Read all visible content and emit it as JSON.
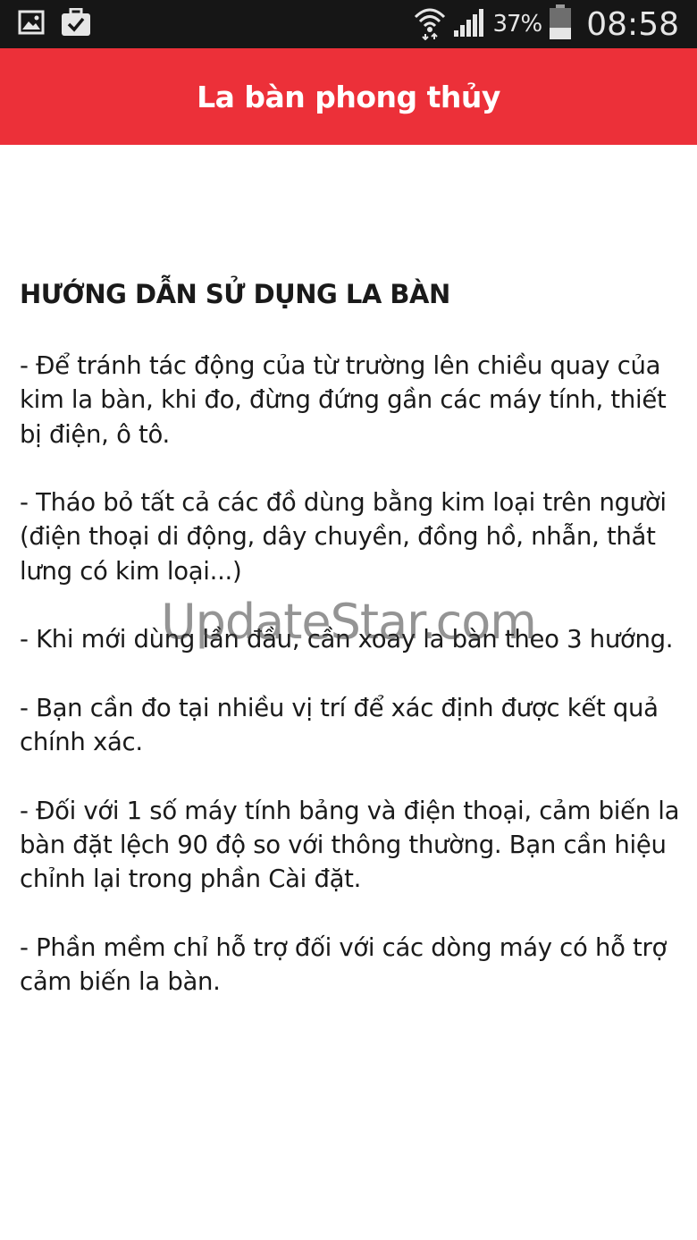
{
  "status_bar": {
    "icons_left": [
      "gallery-icon",
      "briefcase-check-icon"
    ],
    "icons_right": [
      "wifi-icon",
      "signal-icon",
      "battery-icon"
    ],
    "battery_percent": "37%",
    "battery_level": 0.37,
    "time": "08:58"
  },
  "app_bar": {
    "title": "La bàn phong thủy",
    "color": "#ec3039"
  },
  "content": {
    "heading": "HƯỚNG DẪN SỬ DỤNG LA BÀN",
    "paragraphs": [
      "- Để tránh tác động của từ trường lên chiều quay của kim la bàn, khi đo, đừng đứng gần các máy tính, thiết bị điện, ô tô.",
      "- Tháo bỏ tất cả các đồ dùng bằng kim loại trên người (điện thoại di động, dây chuyền, đồng hồ, nhẫn, thắt lưng có kim loại...)",
      "- Khi mới dùng lần đầu, cần xoay la bàn theo 3 hướng.",
      "- Bạn cần đo tại nhiều vị trí để xác định được kết quả chính xác.",
      "- Đối với 1 số máy tính bảng và điện thoại, cảm biến la bàn đặt lệch 90 độ so với thông thường. Bạn cần hiệu chỉnh lại trong phần Cài đặt.",
      "- Phần mềm chỉ hỗ trợ đối với các dòng máy có hỗ trợ cảm biến la bàn."
    ]
  },
  "watermark": "UpdateStar.com"
}
